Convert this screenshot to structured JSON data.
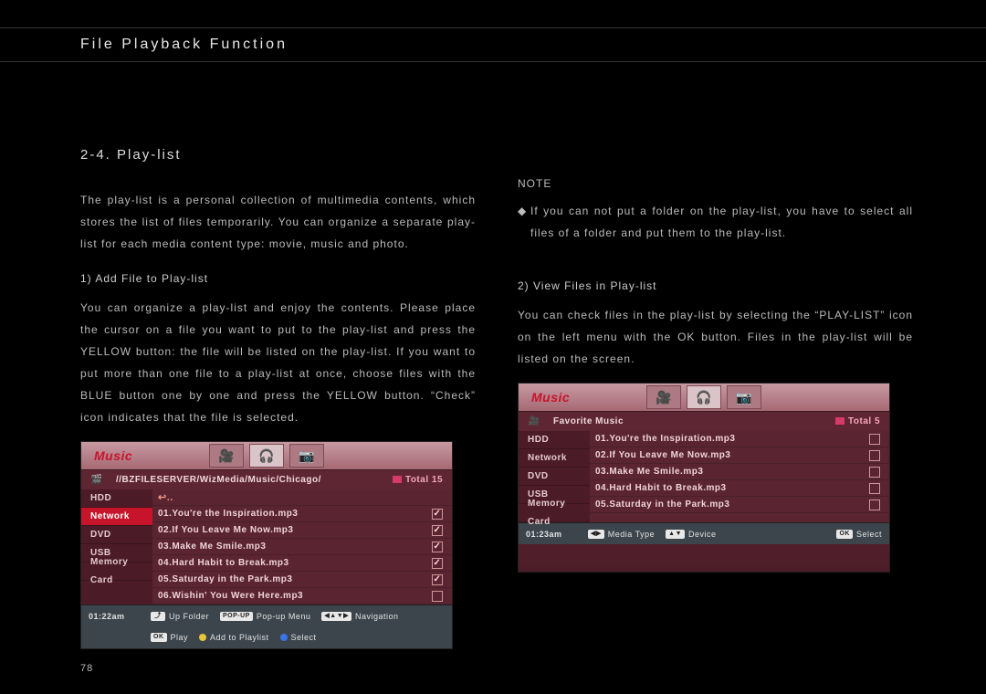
{
  "header": {
    "title": "File Playback Function"
  },
  "section": {
    "title": "2-4. Play-list"
  },
  "page_number": "78",
  "left_column": {
    "intro": "The play-list is a personal collection of multimedia contents, which stores the list of files temporarily. You can organize a separate play-list for each media content type: movie, music and photo.",
    "sub1_title": "1) Add File to Play-list",
    "sub1_body": "You can organize a play-list and enjoy the contents. Please place the cursor on a file you want to put to the play-list and press the YELLOW button: the file will be listed on the play-list. If you want to put more than one file to a play-list at once, choose files with the BLUE button one by one and press the YELLOW button. “Check” icon indicates that the file is selected."
  },
  "right_column": {
    "note_label": "NOTE",
    "note_body": "If you can not put a folder on the play-list, you have to select all files of a folder and put them to the play-list.",
    "sub2_title": "2) View Files in Play-list",
    "sub2_body": "You can check files in the play-list by selecting the “PLAY-LIST” icon on the left menu with the OK button. Files in the play-list will be listed on the screen."
  },
  "shot1": {
    "mode_label": "Music",
    "tabs": [
      "camcorder-icon",
      "headphone-icon",
      "camera-icon"
    ],
    "active_tab": 1,
    "path_icon": "🎬",
    "path": "//BZFILESERVER/WizMedia/Music/Chicago/",
    "total_label": "Total 15",
    "sidebar": [
      "HDD",
      "Network",
      "DVD",
      "USB",
      "Memory Card"
    ],
    "sidebar_selected": 1,
    "folder_up_icon": "↵",
    "files": [
      {
        "name": "01.You're the Inspiration.mp3",
        "checked": true
      },
      {
        "name": "02.If You Leave Me Now.mp3",
        "checked": true
      },
      {
        "name": "03.Make Me Smile.mp3",
        "checked": true
      },
      {
        "name": "04.Hard Habit to Break.mp3",
        "checked": true
      },
      {
        "name": "05.Saturday in the Park.mp3",
        "checked": true
      },
      {
        "name": "06.Wishin' You Were Here.mp3",
        "checked": false
      }
    ],
    "footer_time": "01:22am",
    "footer": {
      "up_tag": "⤴",
      "up": "Up Folder",
      "popup_tag": "POP-UP",
      "popup": "Pop-up Menu",
      "nav_tag": "◀▲▼▶",
      "nav": "Navigation",
      "play_tag": "OK",
      "play": "Play",
      "add": "Add to Playlist",
      "select": "Select"
    }
  },
  "shot2": {
    "mode_label": "Music",
    "tabs": [
      "camcorder-icon",
      "headphone-icon",
      "camera-icon"
    ],
    "active_tab": 1,
    "path_icon": "🎬",
    "path": "Favorite Music",
    "total_label": "Total 5",
    "sidebar": [
      "HDD",
      "Network",
      "DVD",
      "USB",
      "Memory Card"
    ],
    "sidebar_selected": -1,
    "files": [
      {
        "name": "01.You're the Inspiration.mp3",
        "checked": false
      },
      {
        "name": "02.If You Leave Me Now.mp3",
        "checked": false
      },
      {
        "name": "03.Make Me Smile.mp3",
        "checked": false
      },
      {
        "name": "04.Hard Habit to Break.mp3",
        "checked": false
      },
      {
        "name": "05.Saturday in the Park.mp3",
        "checked": false
      }
    ],
    "top_icon": "🎥",
    "footer_time": "01:23am",
    "footer": {
      "mt_tag": "◀▶",
      "mt": "Media Type",
      "dev_tag": "▲▼",
      "dev": "Device",
      "sel_tag": "OK",
      "sel": "Select"
    }
  }
}
